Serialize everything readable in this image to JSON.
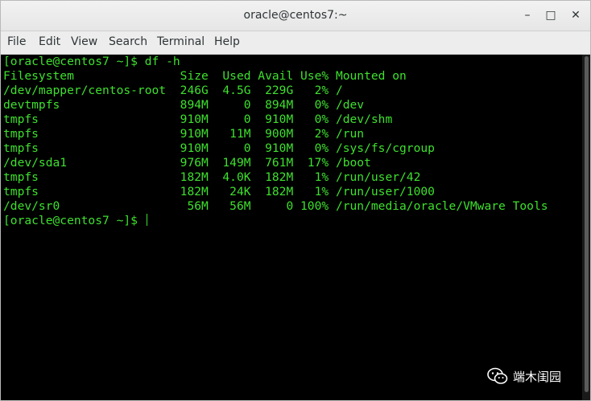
{
  "window": {
    "title": "oracle@centos7:~"
  },
  "controls": {
    "minimize": "–",
    "maximize": "□",
    "close": "✕"
  },
  "menu": [
    "File",
    "Edit",
    "View",
    "Search",
    "Terminal",
    "Help"
  ],
  "terminal": {
    "lines": [
      "[oracle@centos7 ~]$ df -h",
      "Filesystem               Size  Used Avail Use% Mounted on",
      "/dev/mapper/centos-root  246G  4.5G  229G   2% /",
      "devtmpfs                 894M     0  894M   0% /dev",
      "tmpfs                    910M     0  910M   0% /dev/shm",
      "tmpfs                    910M   11M  900M   2% /run",
      "tmpfs                    910M     0  910M   0% /sys/fs/cgroup",
      "/dev/sda1                976M  149M  761M  17% /boot",
      "tmpfs                    182M  4.0K  182M   1% /run/user/42",
      "tmpfs                    182M   24K  182M   1% /run/user/1000",
      "/dev/sr0                  56M   56M     0 100% /run/media/oracle/VMware Tools"
    ],
    "prompt": "[oracle@centos7 ~]$ "
  },
  "watermark": {
    "text": "端木闺园",
    "icon": "wechat-icon"
  },
  "colors": {
    "terminal_fg": "#3ee02e",
    "terminal_bg": "#000000"
  }
}
